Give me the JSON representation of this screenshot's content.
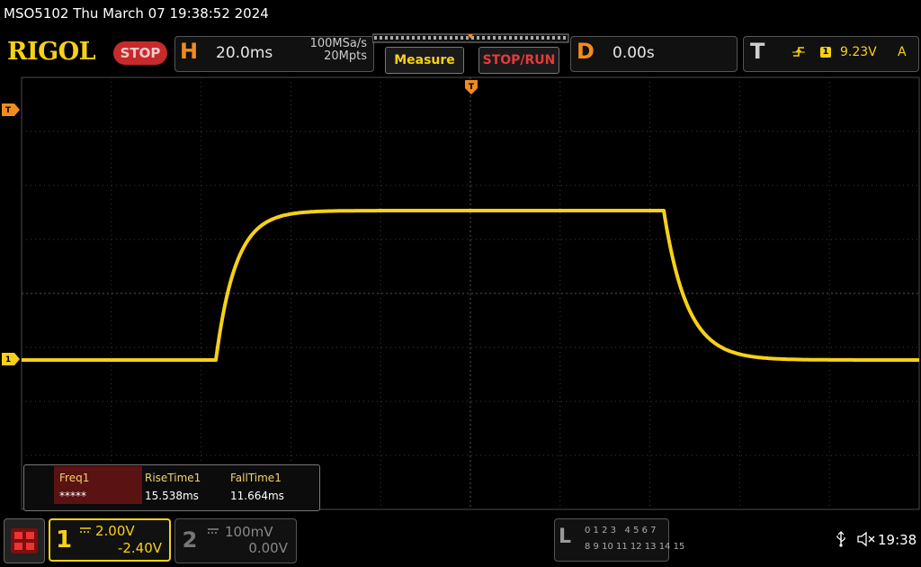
{
  "title": "MSO5102  Thu March 07 19:38:52 2024",
  "brand": "RIGOL",
  "run_state": "STOP",
  "horizontal": {
    "letter": "H",
    "timebase": "20.0ms",
    "sample_rate": "100MSa/s",
    "memory_depth": "20Mpts"
  },
  "buttons": {
    "measure": "Measure",
    "stop_run": "STOP/RUN"
  },
  "delay": {
    "letter": "D",
    "value": "0.00s"
  },
  "trigger": {
    "letter": "T",
    "source": "1",
    "level": "9.23V",
    "mode": "A",
    "marker": "T"
  },
  "ch1_marker": "1",
  "measurements": [
    {
      "label": "Freq1",
      "value": "*****"
    },
    {
      "label": "RiseTime1",
      "value": "15.538ms"
    },
    {
      "label": "FallTime1",
      "value": "11.664ms"
    }
  ],
  "channels": [
    {
      "number": "1",
      "scale": "2.00V",
      "offset": "-2.40V"
    },
    {
      "number": "2",
      "scale": "100mV",
      "offset": "0.00V"
    }
  ],
  "logic": {
    "letter": "L",
    "row1": "0 1 2 3   4 5 6 7",
    "row2": "8 9 10 11 12 13 14 15"
  },
  "clock": "19:38",
  "colors": {
    "ch1": "#f7d117",
    "accent": "#f28b1e",
    "stop": "#c62a2a"
  },
  "icons": [
    "menu-icon",
    "usb-icon",
    "speaker-muted-icon",
    "trigger-edge-icon"
  ]
}
